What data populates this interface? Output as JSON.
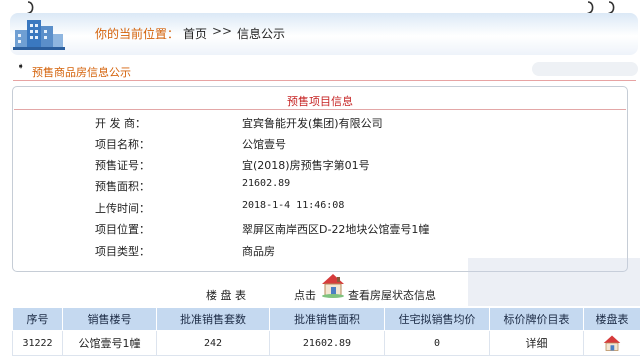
{
  "header": {
    "location_label": "你的当前位置：",
    "home_link": "首页",
    "separator": ">>",
    "current_page": "信息公示"
  },
  "section": {
    "arrow": "➧",
    "title": "预售商品房信息公示"
  },
  "project": {
    "heading": "预售项目信息",
    "fields": [
      {
        "label": "开 发 商：",
        "value": "宜宾鲁能开发(集团)有限公司"
      },
      {
        "label": "项目名称：",
        "value": "公馆壹号"
      },
      {
        "label": "预售证号：",
        "value": "宜(2018)房预售字第01号"
      },
      {
        "label": "预售面积：",
        "value": "21602.89"
      },
      {
        "label": "上传时间：",
        "value": "2018-1-4 11:46:08"
      },
      {
        "label": "项目位置：",
        "value": "翠屏区南岸西区D-22地块公馆壹号1幢"
      },
      {
        "label": "项目类型：",
        "value": "商品房"
      }
    ]
  },
  "building": {
    "label": "楼 盘 表",
    "click_label": "点击",
    "view_link": "查看房屋状态信息"
  },
  "table": {
    "headers": [
      "序号",
      "销售楼号",
      "批准销售套数",
      "批准销售面积",
      "住宅拟销售均价",
      "标价牌价目表",
      "楼盘表"
    ],
    "rows": [
      {
        "id": "31222",
        "building": "公馆壹号1幢",
        "units": "242",
        "area": "21602.89",
        "avg_price": "0",
        "price_list": "详细"
      }
    ]
  },
  "colors": {
    "accent_orange": "#d4620a",
    "heading_red": "#c62424",
    "table_header_bg": "#c5d9f0"
  }
}
